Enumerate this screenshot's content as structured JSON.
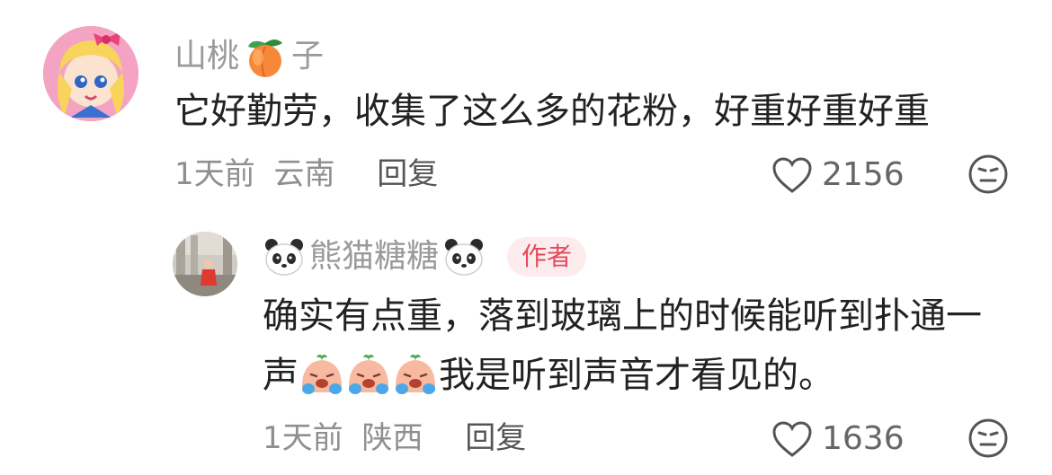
{
  "comments": [
    {
      "username_part1": "山桃",
      "username_part2": "子",
      "name_emoji": "peach-icon",
      "text": "它好勤劳，收集了这么多的花粉，好重好重好重",
      "time": "1天前",
      "location": "云南",
      "reply_label": "回复",
      "likes": "2156"
    },
    {
      "username": "熊猫糖糖",
      "name_emoji": "panda-face-icon",
      "badge": "作者",
      "text_line1": "确实有点重，落到玻璃上的时候能听到扑通一",
      "text_line2_start": "声",
      "inline_emojis": [
        "crying-face-icon",
        "crying-face-icon",
        "crying-face-icon"
      ],
      "text_line2_end": "我是听到声音才看见的。",
      "time": "1天前",
      "location": "陕西",
      "reply_label": "回复",
      "likes": "1636"
    }
  ],
  "colors": {
    "secondary_text": "#9a9a9a",
    "primary_text": "#222222",
    "badge_bg": "#fdecee",
    "badge_text": "#e34a5b"
  }
}
